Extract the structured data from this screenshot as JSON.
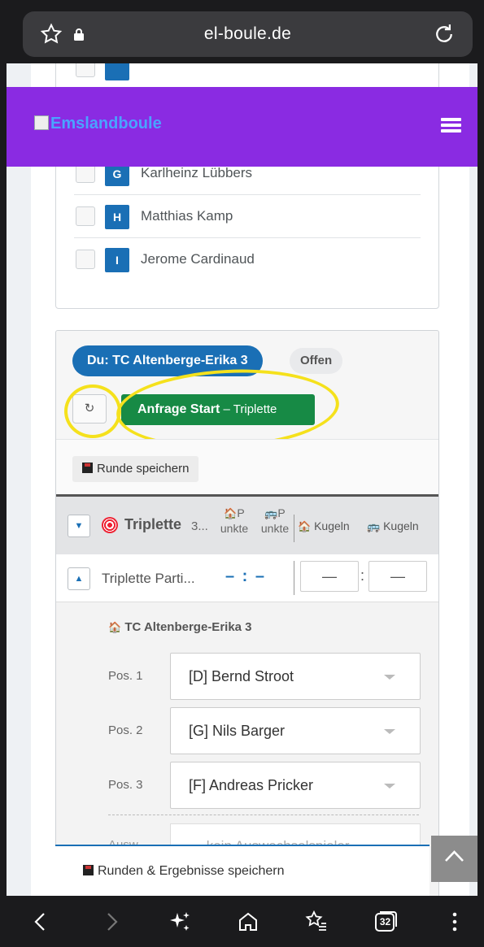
{
  "browser": {
    "url": "el-boule.de",
    "tab_count": "32",
    "icons": [
      "star-icon",
      "lock-icon",
      "reload-icon",
      "back-icon",
      "forward-icon",
      "sparkle-icon",
      "home-icon",
      "bookmarks-icon",
      "tabs-icon",
      "more-icon"
    ]
  },
  "header": {
    "logo_alt": "Emslandboule",
    "menu_icon": "hamburger-icon",
    "bg_color": "#8a2be2"
  },
  "players": [
    {
      "letter": "G",
      "name": "Karlheinz Lübbers"
    },
    {
      "letter": "H",
      "name": "Matthias Kamp"
    },
    {
      "letter": "I",
      "name": "Jerome Cardinaud"
    }
  ],
  "match": {
    "team_label": "Du: TC Altenberge-Erika 3",
    "status": "Offen",
    "refresh_symbol": "↻",
    "start_label": "Anfrage Start",
    "start_sub": " – Triplette",
    "save_round": "Runde speichern",
    "game_type": "Triplette",
    "game_count": "3...",
    "col_home_points": "P unkte",
    "col_guest_points": "P unkte",
    "col_home_balls": "Kugeln",
    "col_guest_balls": "Kugeln",
    "partie_title": "Triplette Parti...",
    "partie_score": "– : –",
    "score_home": "—",
    "score_guest": "—",
    "score_sep": ":",
    "team_name": "TC Altenberge-Erika 3",
    "positions": [
      {
        "label": "Pos. 1",
        "player": "[D] Bernd Stroot"
      },
      {
        "label": "Pos. 2",
        "player": "[G] Nils Barger"
      },
      {
        "label": "Pos. 3",
        "player": "[F] Andreas Pricker"
      }
    ],
    "sub_label": "Ausw...",
    "sub_value": "→ kein Auswechselspieler"
  },
  "footer": {
    "save_all": "Runden & Ergebnisse speichern"
  },
  "colors": {
    "primary": "#1a6fb5",
    "success": "#178a45",
    "annotation": "#f5e11c"
  }
}
